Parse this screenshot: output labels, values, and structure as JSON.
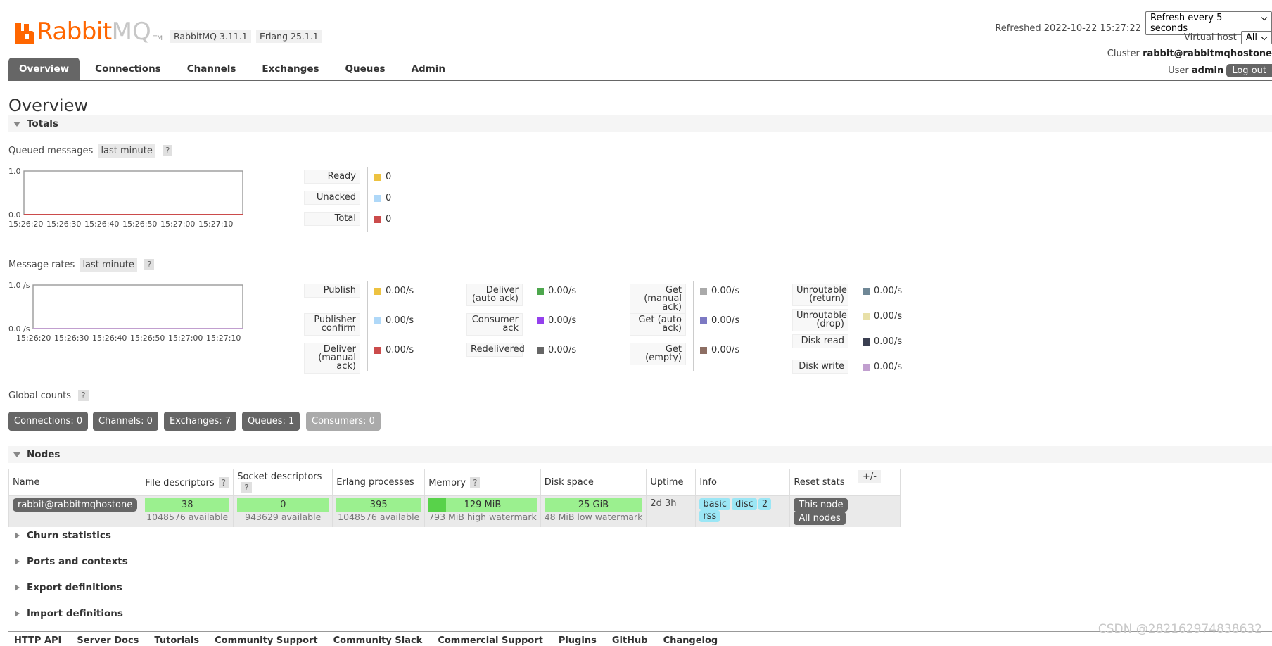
{
  "header": {
    "brand": "Rabbit",
    "brand_suffix": "MQ",
    "tm": "TM",
    "rabbitmq_version": "RabbitMQ 3.11.1",
    "erlang_version": "Erlang 25.1.1",
    "refreshed_label": "Refreshed 2022-10-22 15:27:22",
    "refresh_select": "Refresh every 5 seconds",
    "vhost_label": "Virtual host",
    "vhost_select": "All",
    "cluster_label": "Cluster",
    "cluster_value": "rabbit@rabbitmqhostone",
    "user_label": "User",
    "user_value": "admin",
    "logout": "Log out"
  },
  "tabs": [
    "Overview",
    "Connections",
    "Channels",
    "Exchanges",
    "Queues",
    "Admin"
  ],
  "page_title": "Overview",
  "totals": {
    "section": "Totals",
    "queued": {
      "label": "Queued messages",
      "range": "last minute",
      "help": "?",
      "legend": [
        {
          "label": "Ready",
          "value": "0",
          "color": "#edc240"
        },
        {
          "label": "Unacked",
          "value": "0",
          "color": "#afd8f8"
        },
        {
          "label": "Total",
          "value": "0",
          "color": "#cb4b4b"
        }
      ]
    },
    "rates": {
      "label": "Message rates",
      "range": "last minute",
      "help": "?",
      "col1": [
        {
          "label": "Publish",
          "value": "0.00/s",
          "color": "#edc240"
        },
        {
          "label": "Publisher confirm",
          "value": "0.00/s",
          "color": "#afd8f8"
        },
        {
          "label": "Deliver (manual ack)",
          "value": "0.00/s",
          "color": "#cb4b4b"
        }
      ],
      "col2": [
        {
          "label": "Deliver (auto ack)",
          "value": "0.00/s",
          "color": "#4da74d"
        },
        {
          "label": "Consumer ack",
          "value": "0.00/s",
          "color": "#9440ed"
        },
        {
          "label": "Redelivered",
          "value": "0.00/s",
          "color": "#666666"
        }
      ],
      "col3": [
        {
          "label": "Get (manual ack)",
          "value": "0.00/s",
          "color": "#aaaaaa"
        },
        {
          "label": "Get (auto ack)",
          "value": "0.00/s",
          "color": "#7c79c3"
        },
        {
          "label": "Get (empty)",
          "value": "0.00/s",
          "color": "#8d6e63"
        }
      ],
      "col4": [
        {
          "label": "Unroutable (return)",
          "value": "0.00/s",
          "color": "#6f8796"
        },
        {
          "label": "Unroutable (drop)",
          "value": "0.00/s",
          "color": "#e8e0a8"
        },
        {
          "label": "Disk read",
          "value": "0.00/s",
          "color": "#3a3f51"
        },
        {
          "label": "Disk write",
          "value": "0.00/s",
          "color": "#c19fcf"
        }
      ]
    },
    "global": {
      "label": "Global counts",
      "help": "?",
      "counts": [
        "Connections: 0",
        "Channels: 0",
        "Exchanges: 7",
        "Queues: 1",
        "Consumers: 0"
      ]
    }
  },
  "chart_data": [
    {
      "type": "line",
      "title": "Queued messages",
      "x": [
        "15:26:20",
        "15:26:30",
        "15:26:40",
        "15:26:50",
        "15:27:00",
        "15:27:10"
      ],
      "series": [
        {
          "name": "Ready",
          "values": [
            0,
            0,
            0,
            0,
            0,
            0
          ]
        },
        {
          "name": "Unacked",
          "values": [
            0,
            0,
            0,
            0,
            0,
            0
          ]
        },
        {
          "name": "Total",
          "values": [
            0,
            0,
            0,
            0,
            0,
            0
          ]
        }
      ],
      "yticks": [
        "1.0",
        "0.0"
      ],
      "ylim": [
        0,
        1
      ]
    },
    {
      "type": "line",
      "title": "Message rates",
      "x": [
        "15:26:20",
        "15:26:30",
        "15:26:40",
        "15:26:50",
        "15:27:00",
        "15:27:10"
      ],
      "series": [
        {
          "name": "Publish",
          "values": [
            0,
            0,
            0,
            0,
            0,
            0
          ]
        }
      ],
      "yticks": [
        "1.0 /s",
        "0.0 /s"
      ],
      "ylim": [
        0,
        1
      ]
    }
  ],
  "nodes": {
    "section": "Nodes",
    "headers": [
      "Name",
      "File descriptors",
      "Socket descriptors",
      "Erlang processes",
      "Memory",
      "Disk space",
      "Uptime",
      "Info",
      "Reset stats"
    ],
    "help": "?",
    "plusminus": "+/-",
    "row": {
      "name": "rabbit@rabbitmqhostone",
      "fd": "38",
      "fd_sub": "1048576 available",
      "sockets": "0",
      "sockets_sub": "943629 available",
      "procs": "395",
      "procs_sub": "1048576 available",
      "memory": "129 MiB",
      "memory_sub": "793 MiB high watermark",
      "memory_fraction": 0.16,
      "disk": "25 GiB",
      "disk_sub": "48 MiB low watermark",
      "uptime": "2d 3h",
      "info": [
        "basic",
        "disc",
        "2",
        "rss"
      ],
      "reset": [
        "This node",
        "All nodes"
      ]
    }
  },
  "collapsed": [
    "Churn statistics",
    "Ports and contexts",
    "Export definitions",
    "Import definitions"
  ],
  "footer": [
    "HTTP API",
    "Server Docs",
    "Tutorials",
    "Community Support",
    "Community Slack",
    "Commercial Support",
    "Plugins",
    "GitHub",
    "Changelog"
  ],
  "watermark": "CSDN @282162974838632"
}
